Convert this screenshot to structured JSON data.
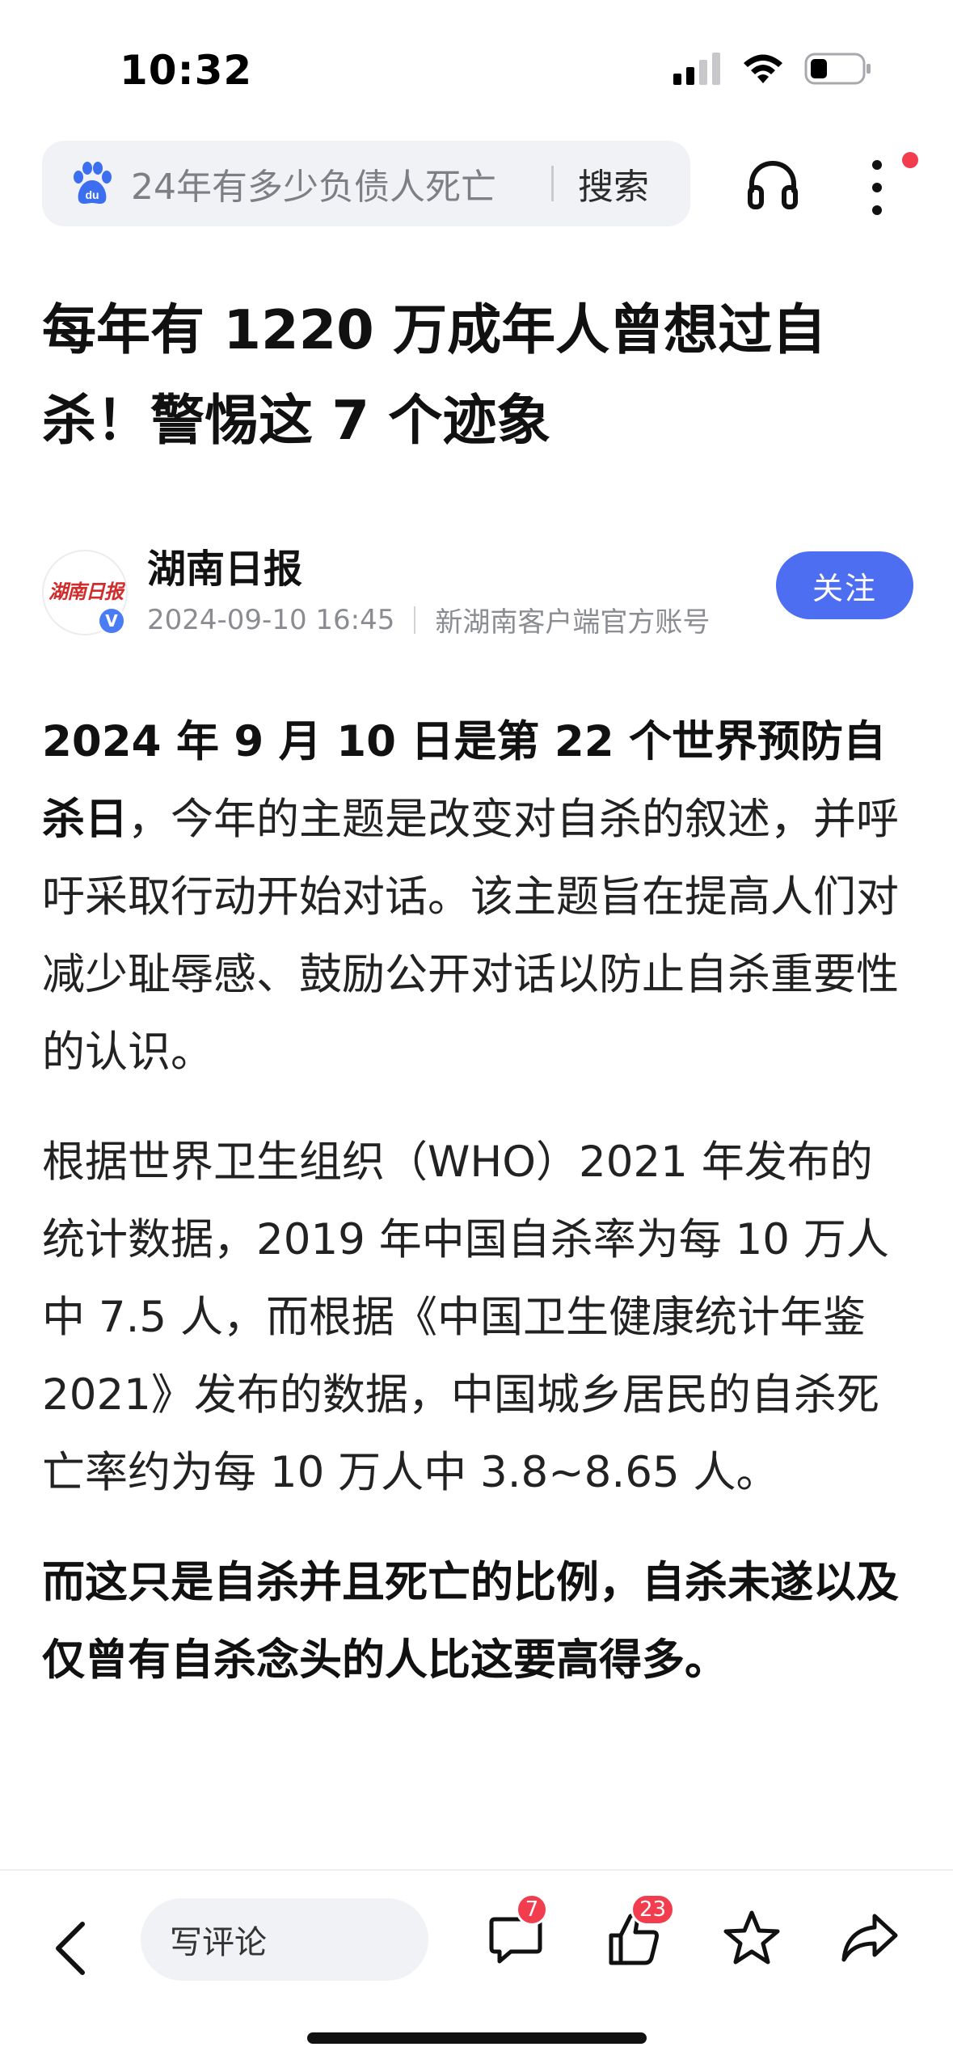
{
  "status_bar": {
    "time": "10:32"
  },
  "search": {
    "placeholder": "24年有多少负债人死亡",
    "button_label": "搜索"
  },
  "article": {
    "title": "每年有 1220 万成年人曾想过自杀！警惕这 7 个迹象",
    "author": {
      "name": "湖南日报",
      "avatar_text": "湖南日报",
      "date": "2024-09-10 16:45",
      "source": "新湖南客户端官方账号",
      "follow_label": "关注"
    },
    "paragraphs": [
      {
        "lead_bold": "2024 年 9 月 10 日是第 22 个世界预防自杀日",
        "rest": "，今年的主题是改变对自杀的叙述，并呼吁采取行动开始对话。该主题旨在提高人们对减少耻辱感、鼓励公开对话以防止自杀重要性的认识。"
      },
      {
        "text": "根据世界卫生组织（WHO）2021 年发布的统计数据，2019 年中国自杀率为每 10 万人中 7.5 人，而根据《中国卫生健康统计年鉴 2021》发布的数据，中国城乡居民的自杀死亡率约为每 10 万人中 3.8~8.65 人。"
      },
      {
        "bold_text": "而这只是自杀并且死亡的比例，自杀未遂以及仅曾有自杀念头的人比这要高得多。"
      }
    ]
  },
  "bottom_bar": {
    "comment_placeholder": "写评论",
    "comment_count": "7",
    "like_count": "23"
  },
  "colors": {
    "accent": "#4e6ef2",
    "badge": "#f23d4f",
    "search_bg": "#f1f2f5"
  },
  "icons": [
    "baidu-paw-icon",
    "headphones-icon",
    "more-vertical-icon",
    "back-arrow-icon",
    "comment-icon",
    "thumbs-up-icon",
    "star-icon",
    "share-icon",
    "signal-icon",
    "wifi-icon",
    "battery-icon"
  ]
}
